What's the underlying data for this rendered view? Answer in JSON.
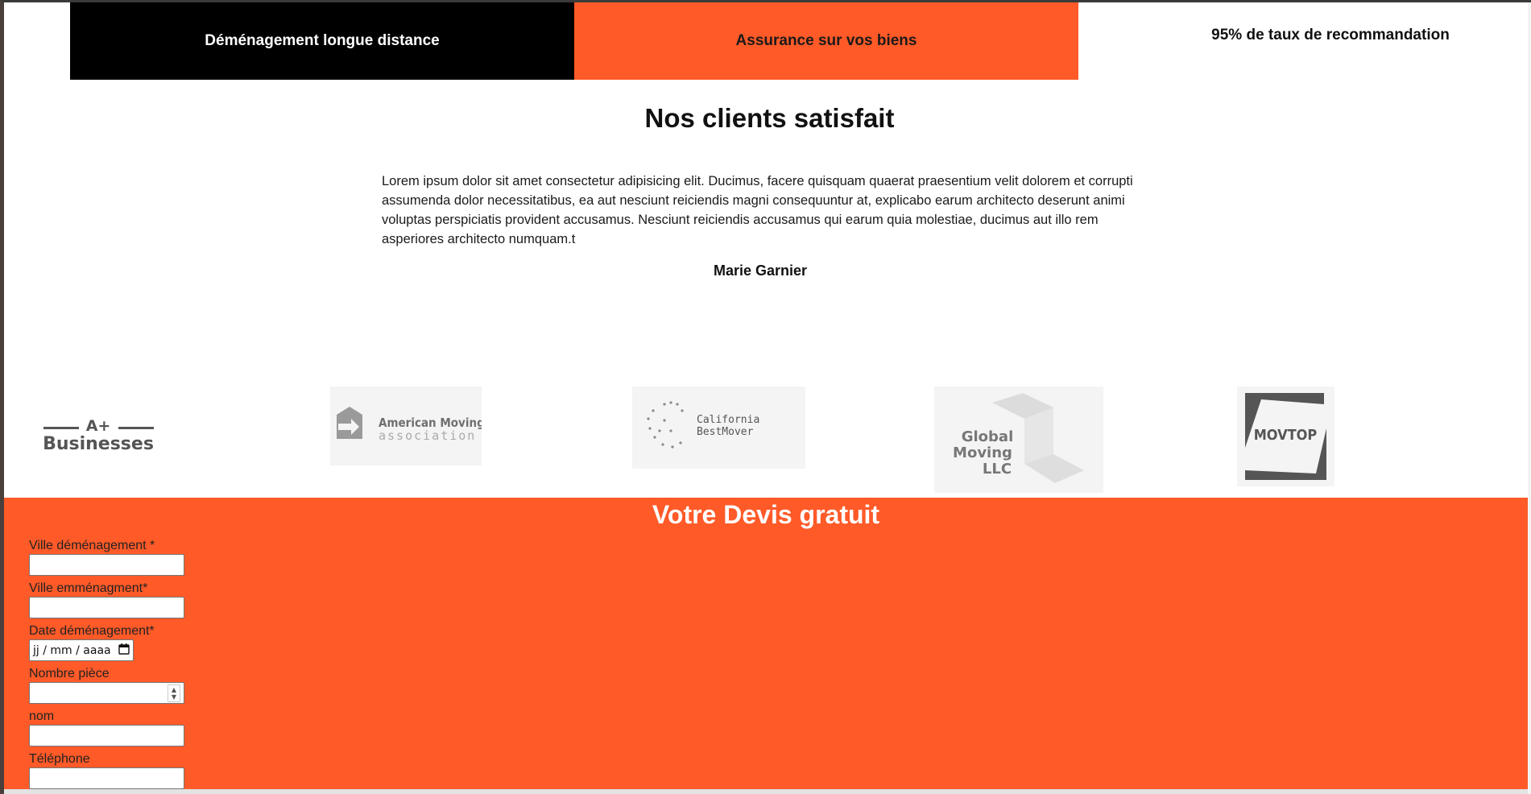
{
  "features": {
    "tab1": "Déménagement longue distance",
    "tab2": "Assurance sur vos biens",
    "tab3": "95% de taux de recommandation"
  },
  "clients": {
    "title": "Nos clients satisfait",
    "testimonial": "Lorem ipsum dolor sit amet consectetur adipisicing elit. Ducimus, facere quisquam quaerat praesentium velit dolorem et corrupti assumenda dolor necessitatibus, ea aut nesciunt reiciendis magni consequuntur at, explicabo earum architecto deserunt animi voluptas perspiciatis provident accusamus. Nesciunt reiciendis accusamus qui earum quia molestiae, ducimus aut illo rem asperiores architecto numquam.t",
    "author": "Marie Garnier"
  },
  "partners": [
    {
      "name": "A+ Businesses",
      "icon": "aplus-businesses-logo"
    },
    {
      "name": "American Moving association",
      "icon": "american-moving-association-logo"
    },
    {
      "name": "California BestMover",
      "icon": "california-bestmover-logo"
    },
    {
      "name": "Global Moving LLC",
      "icon": "global-moving-llc-logo"
    },
    {
      "name": "MOVTOP",
      "icon": "movtop-logo"
    }
  ],
  "quote": {
    "title": "Votre Devis gratuit",
    "fields": {
      "ville_demenagement": "Ville déménagement *",
      "ville_emmenagement": "Ville emménagment*",
      "date_demenagement": "Date déménagement*",
      "date_placeholder": "jj / mm / aaaa",
      "nombre_piece": "Nombre pièce",
      "nom": "nom",
      "telephone": "Téléphone"
    }
  },
  "colors": {
    "accent": "#ff5a28",
    "dark": "#000000"
  }
}
